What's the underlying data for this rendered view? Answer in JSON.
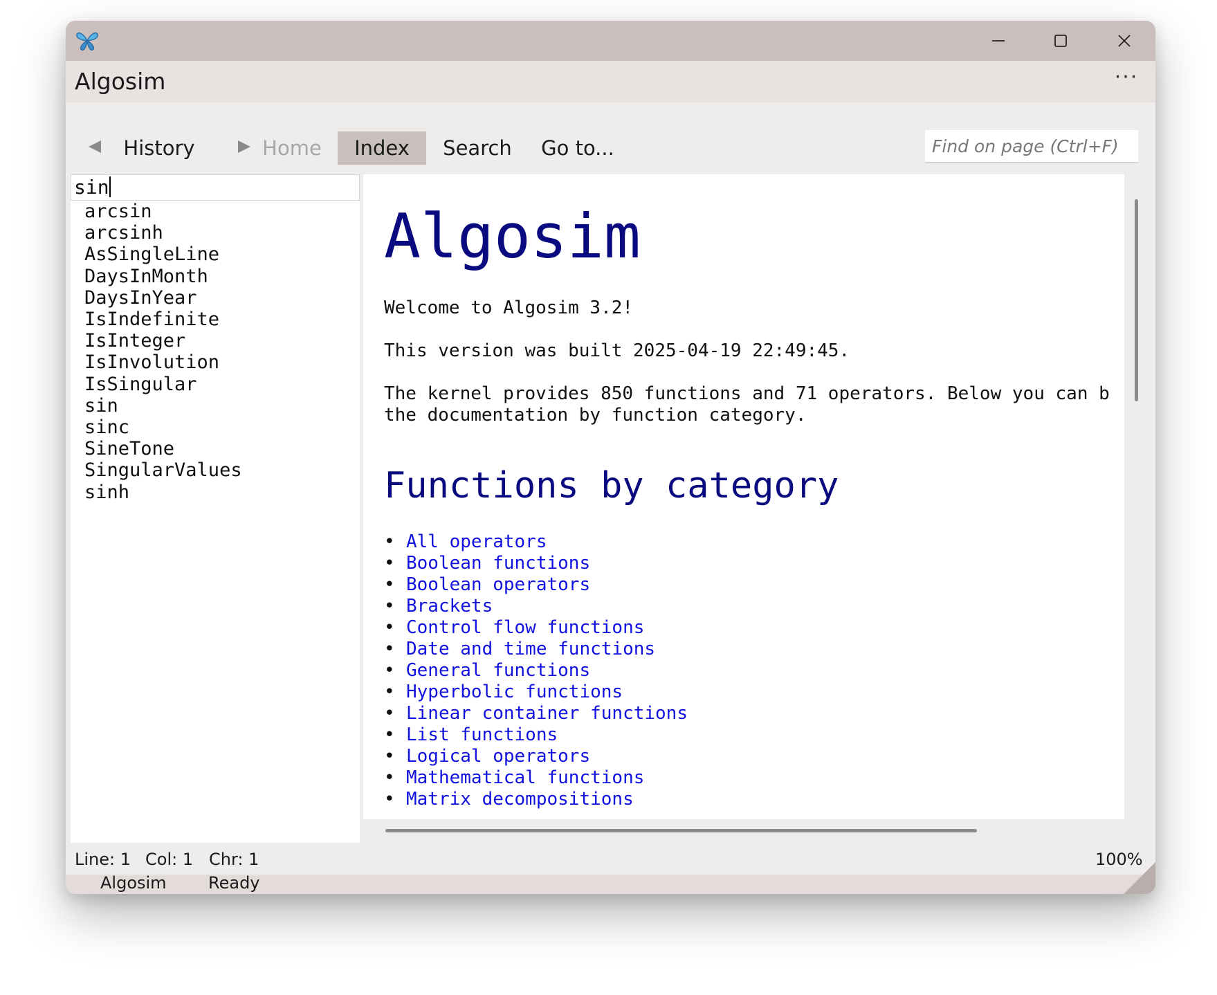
{
  "window": {
    "app_name": "Algosim",
    "more_label": "···"
  },
  "toolbar": {
    "history_label": "History",
    "home_label": "Home",
    "index_label": "Index",
    "search_label": "Search",
    "goto_label": "Go to...",
    "find_placeholder": "Find on page (Ctrl+F)"
  },
  "index": {
    "query": "sin",
    "items": [
      "arcsin",
      "arcsinh",
      "AsSingleLine",
      "DaysInMonth",
      "DaysInYear",
      "IsIndefinite",
      "IsInteger",
      "IsInvolution",
      "IsSingular",
      "sin",
      "sinc",
      "SineTone",
      "SingularValues",
      "sinh"
    ]
  },
  "content": {
    "title": "Algosim",
    "paragraphs": [
      "Welcome to Algosim 3.2!",
      "This version was built 2025-04-19 22:49:45.",
      "The kernel provides 850 functions and 71 operators. Below you can b"
    ],
    "paragraph3_line2": "the documentation by function category.",
    "section_title": "Functions by category",
    "categories": [
      "All operators",
      "Boolean functions",
      "Boolean operators",
      "Brackets",
      "Control flow functions",
      "Date and time functions",
      "General functions",
      "Hyperbolic functions",
      "Linear container functions",
      "List functions",
      "Logical operators",
      "Mathematical functions",
      "Matrix decompositions"
    ]
  },
  "statusbar": {
    "line": "Line: 1",
    "col": "Col: 1",
    "chr": "Chr: 1",
    "zoom": "100%",
    "app": "Algosim",
    "status": "Ready"
  },
  "colors": {
    "title_bar": "#cbbfbd",
    "heading": "#0a0a80",
    "link": "#1212e0",
    "active_tab": "#c9bfbd"
  }
}
